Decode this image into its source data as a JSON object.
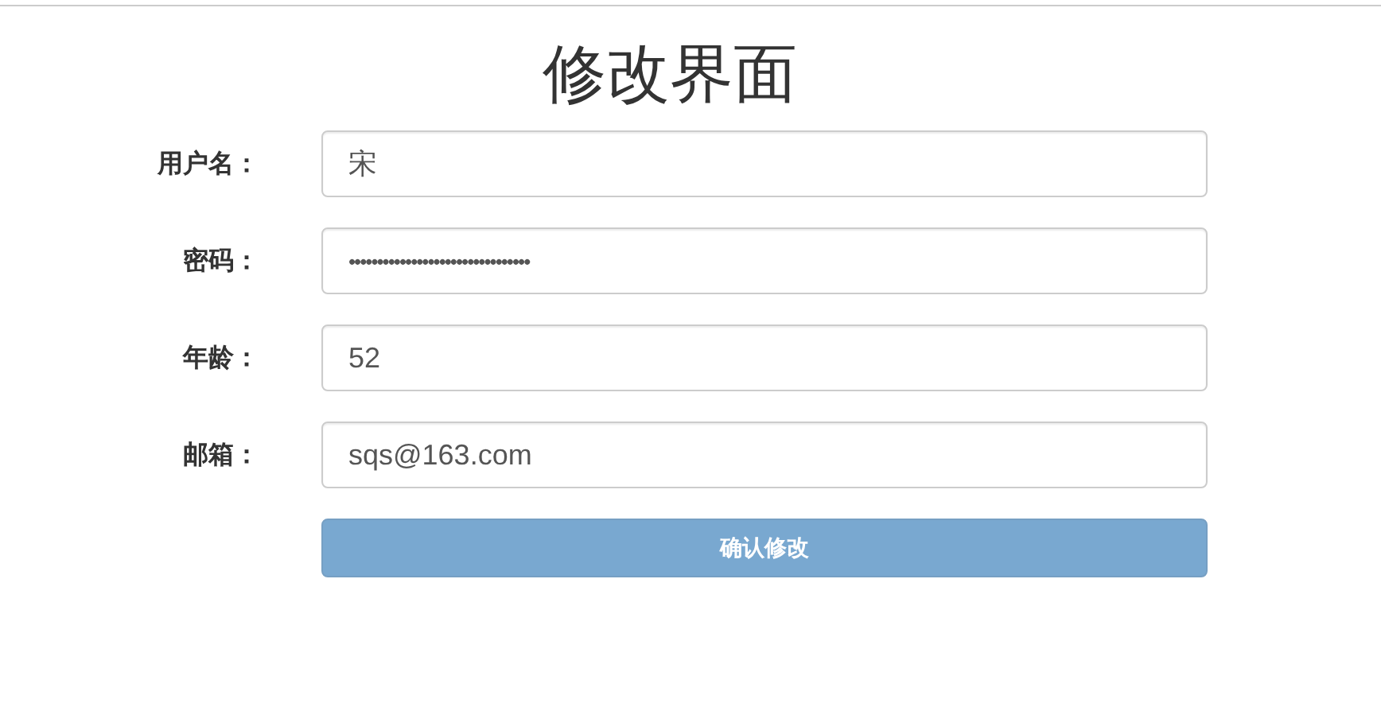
{
  "title": "修改界面",
  "fields": [
    {
      "label": "用户名：",
      "value": "宋",
      "kind": "text"
    },
    {
      "label": "密码：",
      "value": "••••••••••••••••••••••••••••••••",
      "kind": "password"
    },
    {
      "label": "年龄：",
      "value": "52",
      "kind": "text"
    },
    {
      "label": "邮箱：",
      "value": "sqs@163.com",
      "kind": "text"
    }
  ],
  "submit": {
    "label": "确认修改",
    "disabled": true
  }
}
